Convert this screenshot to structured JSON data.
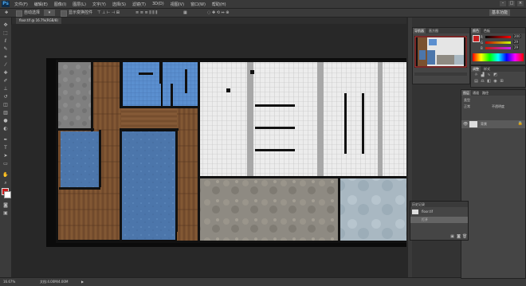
{
  "app": {
    "logo": "Ps"
  },
  "menu": {
    "items": [
      "文件(F)",
      "编辑(E)",
      "图像(I)",
      "图层(L)",
      "文字(Y)",
      "选择(S)",
      "滤镜(T)",
      "3D(D)",
      "视图(V)",
      "窗口(W)",
      "帮助(H)"
    ]
  },
  "window_buttons": [
    "–",
    "□",
    "×"
  ],
  "options_bar": {
    "auto_select_label": "自动选择",
    "transform_label": "显示变换控件",
    "workspace_label": "基本功能"
  },
  "document": {
    "tab_label": "floor.tif @ 16.7%(RGB/8)"
  },
  "status": {
    "zoom": "16.67%",
    "doc_size": "文档:4.00M/4.00M",
    "arrow": "▶"
  },
  "navigator": {
    "tabs": [
      "导航器",
      "直方图"
    ]
  },
  "color_panel": {
    "tabs": [
      "颜色",
      "色板"
    ],
    "r_label": "R",
    "g_label": "G",
    "b_label": "B",
    "r_value": "200",
    "g_value": "29",
    "b_value": "29"
  },
  "adjustments": {
    "tabs": [
      "调整",
      "样式"
    ]
  },
  "layers_panel": {
    "tabs": [
      "图层",
      "通道",
      "路径"
    ],
    "kind_label": "类型",
    "mode_label": "正常",
    "opacity_label": "不透明度",
    "layer_name": "背景"
  },
  "float_panel": {
    "title": "历史记录",
    "items": [
      "floor.tif",
      "打开"
    ]
  },
  "colors": {
    "foreground": "#c81d1d",
    "background": "#ffffff",
    "accent": "#2f6ea8",
    "floor_blue": "#4f78ad",
    "wood": "#7a5130",
    "tile": "#e8e8e8",
    "stone": "#8f8a80"
  },
  "floorplan": {
    "rooms": [
      {
        "name": "concrete-room",
        "material": "concrete"
      },
      {
        "name": "wood-corridor",
        "material": "wood"
      },
      {
        "name": "bath-tiles",
        "material": "blue-tile"
      },
      {
        "name": "blue-room-left",
        "material": "blue"
      },
      {
        "name": "blue-room-center",
        "material": "blue"
      },
      {
        "name": "white-tile-hall",
        "material": "white-tile"
      },
      {
        "name": "stone-room",
        "material": "stone"
      },
      {
        "name": "marble-room",
        "material": "marble"
      }
    ]
  }
}
